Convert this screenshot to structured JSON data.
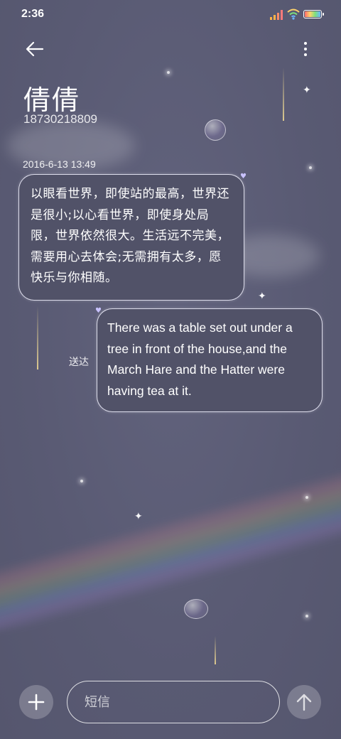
{
  "status_bar": {
    "time": "2:36",
    "icons": [
      "signal-icon",
      "wifi-icon",
      "battery-icon"
    ]
  },
  "header": {
    "back_icon": "arrow-left-icon",
    "more_icon": "more-vertical-icon",
    "contact_name": "倩倩",
    "contact_number": "18730218809"
  },
  "conversation": {
    "timestamp": "2016-6-13 13:49",
    "messages": [
      {
        "direction": "incoming",
        "text": "以眼看世界，即使站的最高，世界还是很小;以心看世界，即使身处局限，世界依然很大。生活远不完美，需要用心去体会;无需拥有太多，愿快乐与你相随。"
      },
      {
        "direction": "outgoing",
        "text": "There was a table set out under a tree in front of the house,and the March Hare and the Hatter were having tea at it.",
        "status": "送达"
      }
    ]
  },
  "composer": {
    "add_icon": "plus-icon",
    "placeholder": "短信",
    "value": "",
    "send_icon": "arrow-up-icon"
  },
  "colors": {
    "background": "#5b5c76",
    "bubble_fill": "#515268",
    "bubble_border": "#ebebfa",
    "accent_heart": "#c9c2ff"
  }
}
